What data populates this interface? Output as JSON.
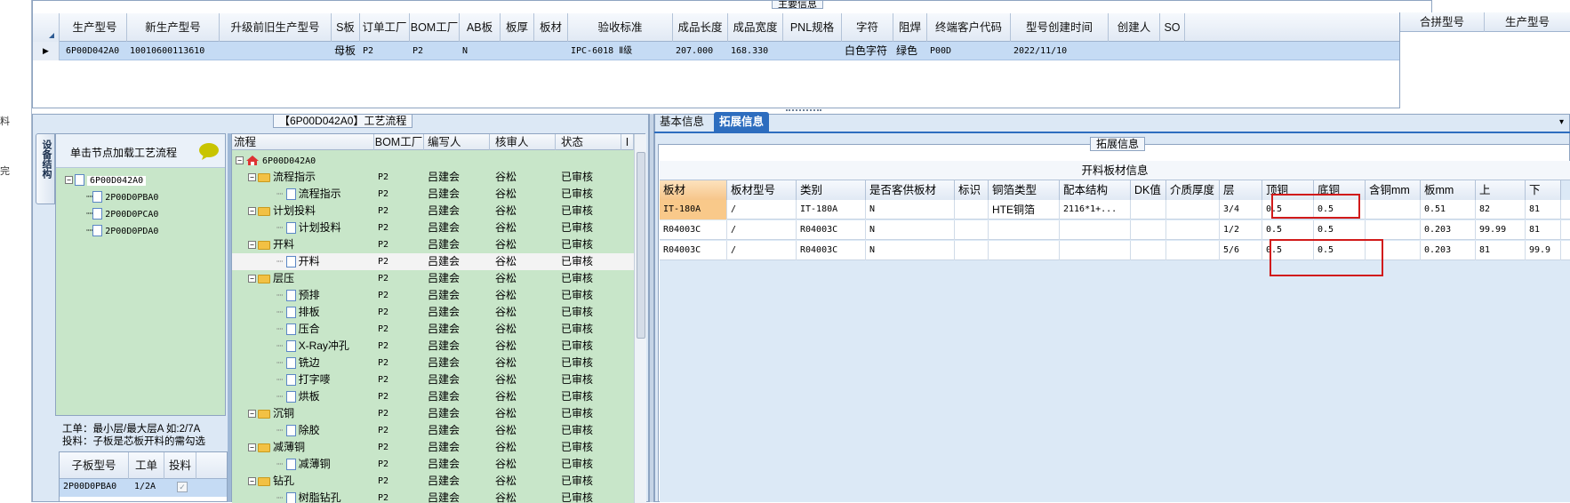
{
  "left_strip": {
    "chars": [
      "料",
      "完"
    ]
  },
  "main_info": {
    "group_title": "主要信息",
    "headers": [
      "生产型号",
      "新生产型号",
      "升级前旧生产型号",
      "S板",
      "订单工厂",
      "BOM工厂",
      "AB板",
      "板厚",
      "板材",
      "验收标准",
      "成品长度",
      "成品宽度",
      "PNL规格",
      "字符",
      "阻焊",
      "终端客户代码",
      "型号创建时间",
      "创建人",
      "SO"
    ],
    "row": [
      "6P00D042A0",
      "10010600113610",
      "",
      "母板",
      "P2",
      "P2",
      "N",
      "",
      "",
      "IPC-6018 Ⅱ级",
      "207.000",
      "168.330",
      "",
      "白色字符",
      "绿色",
      "P00D",
      "2022/11/10",
      "",
      ""
    ],
    "right_headers": [
      "合拼型号",
      "生产型号"
    ]
  },
  "process_panel": {
    "title": "【6P00D042A0】工艺流程",
    "side_tab": "设备结构",
    "load_hint": "单击节点加载工艺流程",
    "device_tree": {
      "root": "6P00D042A0",
      "children": [
        "2P00D0PBA0",
        "2P00D0PCA0",
        "2P00D0PDA0"
      ]
    },
    "notes": [
      "工单：最小层/最大层A 如:2/7A",
      "投料：子板是芯板开料的需勾选"
    ],
    "sub_table": {
      "headers": [
        "子板型号",
        "工单",
        "投料"
      ],
      "rows": [
        [
          "2P00D0PBA0",
          "1/2A",
          "✓"
        ]
      ]
    },
    "flow_headers": [
      "流程",
      "BOM工厂",
      "编写人",
      "核审人",
      "状态",
      "I"
    ],
    "flow_root": "6P00D042A0",
    "flow_rows": [
      {
        "level": 1,
        "icon": "folder",
        "name": "流程指示",
        "bom": "P2",
        "author": "吕建会",
        "reviewer": "谷松",
        "status": "已审核"
      },
      {
        "level": 2,
        "icon": "doc",
        "name": "流程指示",
        "bom": "P2",
        "author": "吕建会",
        "reviewer": "谷松",
        "status": "已审核"
      },
      {
        "level": 1,
        "icon": "folder",
        "name": "计划投料",
        "bom": "P2",
        "author": "吕建会",
        "reviewer": "谷松",
        "status": "已审核"
      },
      {
        "level": 2,
        "icon": "doc",
        "name": "计划投料",
        "bom": "P2",
        "author": "吕建会",
        "reviewer": "谷松",
        "status": "已审核"
      },
      {
        "level": 1,
        "icon": "folder",
        "name": "开料",
        "bom": "P2",
        "author": "吕建会",
        "reviewer": "谷松",
        "status": "已审核"
      },
      {
        "level": 2,
        "icon": "doc",
        "name": "开料",
        "bom": "P2",
        "author": "吕建会",
        "reviewer": "谷松",
        "status": "已审核",
        "selected": true
      },
      {
        "level": 1,
        "icon": "folder",
        "name": "层压",
        "bom": "P2",
        "author": "吕建会",
        "reviewer": "谷松",
        "status": "已审核"
      },
      {
        "level": 2,
        "icon": "doc",
        "name": "预排",
        "bom": "P2",
        "author": "吕建会",
        "reviewer": "谷松",
        "status": "已审核"
      },
      {
        "level": 2,
        "icon": "doc",
        "name": "排板",
        "bom": "P2",
        "author": "吕建会",
        "reviewer": "谷松",
        "status": "已审核"
      },
      {
        "level": 2,
        "icon": "doc",
        "name": "压合",
        "bom": "P2",
        "author": "吕建会",
        "reviewer": "谷松",
        "status": "已审核"
      },
      {
        "level": 2,
        "icon": "doc",
        "name": "X-Ray冲孔",
        "bom": "P2",
        "author": "吕建会",
        "reviewer": "谷松",
        "status": "已审核"
      },
      {
        "level": 2,
        "icon": "doc",
        "name": "铣边",
        "bom": "P2",
        "author": "吕建会",
        "reviewer": "谷松",
        "status": "已审核"
      },
      {
        "level": 2,
        "icon": "doc",
        "name": "打字嘜",
        "bom": "P2",
        "author": "吕建会",
        "reviewer": "谷松",
        "status": "已审核"
      },
      {
        "level": 2,
        "icon": "doc",
        "name": "烘板",
        "bom": "P2",
        "author": "吕建会",
        "reviewer": "谷松",
        "status": "已审核"
      },
      {
        "level": 1,
        "icon": "folder",
        "name": "沉铜",
        "bom": "P2",
        "author": "吕建会",
        "reviewer": "谷松",
        "status": "已审核"
      },
      {
        "level": 2,
        "icon": "doc",
        "name": "除胶",
        "bom": "P2",
        "author": "吕建会",
        "reviewer": "谷松",
        "status": "已审核"
      },
      {
        "level": 1,
        "icon": "folder",
        "name": "减薄铜",
        "bom": "P2",
        "author": "吕建会",
        "reviewer": "谷松",
        "status": "已审核"
      },
      {
        "level": 2,
        "icon": "doc",
        "name": "减薄铜",
        "bom": "P2",
        "author": "吕建会",
        "reviewer": "谷松",
        "status": "已审核"
      },
      {
        "level": 1,
        "icon": "folder",
        "name": "钻孔",
        "bom": "P2",
        "author": "吕建会",
        "reviewer": "谷松",
        "status": "已审核"
      },
      {
        "level": 2,
        "icon": "doc",
        "name": "树脂钻孔",
        "bom": "P2",
        "author": "吕建会",
        "reviewer": "谷松",
        "status": "已审核"
      }
    ]
  },
  "detail_panel": {
    "tabs": [
      "基本信息",
      "拓展信息"
    ],
    "active_tab": 1,
    "group_title": "拓展信息",
    "grid_title": "开料板材信息",
    "headers": [
      "板材",
      "板材型号",
      "类别",
      "是否客供板材",
      "标识",
      "铜箔类型",
      "配本结构",
      "DK值",
      "介质厚度",
      "层",
      "顶铜",
      "底铜",
      "含铜mm",
      "板mm",
      "上",
      "下"
    ],
    "rows": [
      [
        "IT-180A",
        "/",
        "IT-180A",
        "N",
        "",
        "HTE铜箔",
        "2116*1+...",
        "",
        "",
        "3/4",
        "0.5",
        "0.5",
        "",
        "0.51",
        "82",
        "81"
      ],
      [
        "R04003C",
        "/",
        "R04003C",
        "N",
        "",
        "",
        "",
        "",
        "",
        "1/2",
        "0.5",
        "0.5",
        "",
        "0.203",
        "99.99",
        "81"
      ],
      [
        "R04003C",
        "/",
        "R04003C",
        "N",
        "",
        "",
        "",
        "",
        "",
        "5/6",
        "0.5",
        "0.5",
        "",
        "0.203",
        "81",
        "99.9"
      ]
    ]
  },
  "colors": {
    "accent_tab": "#2d6dbf",
    "selected_row": "#c5dbf4",
    "tree_bg": "#c8e6c9",
    "annotation_red": "#d11a1a",
    "highlight_cell": "#f9c98a"
  }
}
